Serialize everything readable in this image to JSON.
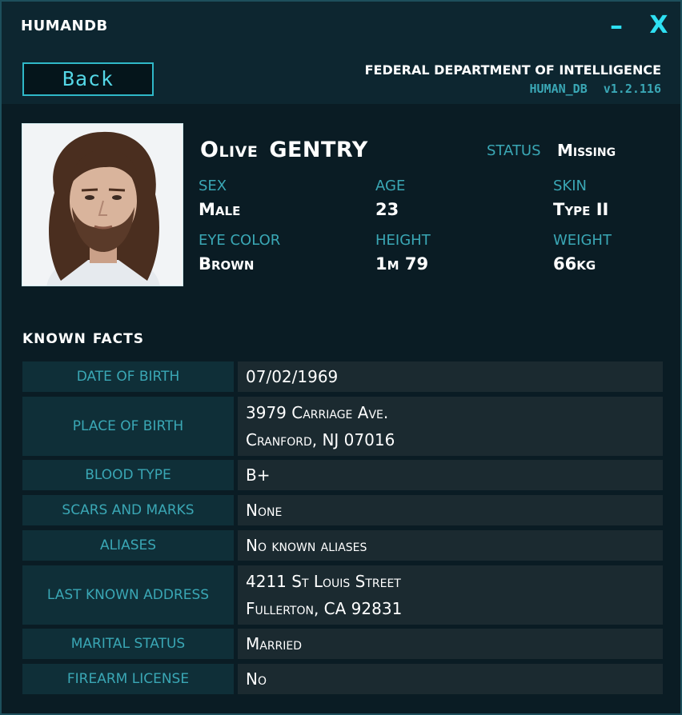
{
  "app": {
    "title": "HUMANDB",
    "minimize_glyph": "–",
    "close_glyph": "X"
  },
  "header": {
    "back_label": "Back",
    "agency": "FEDERAL DEPARTMENT OF INTELLIGENCE",
    "db_name": "HUMAN_DB",
    "version": "v1.2.116"
  },
  "profile": {
    "first_name": "Olive",
    "last_name": "GENTRY",
    "status_label": "STATUS",
    "status_value": "Missing",
    "sex_label": "SEX",
    "sex": "Male",
    "age_label": "AGE",
    "age": "23",
    "skin_label": "SKIN",
    "skin": "Type II",
    "eye_label": "EYE COLOR",
    "eye": "Brown",
    "height_label": "HEIGHT",
    "height": "1m 79",
    "weight_label": "WEIGHT",
    "weight": "66kg"
  },
  "facts": {
    "title_a": "KNOWN",
    "title_b": "FACTS",
    "rows": [
      {
        "label": "DATE OF BIRTH",
        "lines": [
          "07/02/1969"
        ]
      },
      {
        "label": "PLACE OF BIRTH",
        "lines": [
          "3979 Carriage Ave.",
          "Cranford, NJ 07016"
        ]
      },
      {
        "label": "BLOOD TYPE",
        "lines": [
          "B+"
        ]
      },
      {
        "label": "SCARS AND MARKS",
        "lines": [
          "None"
        ]
      },
      {
        "label": "ALIASES",
        "lines": [
          "No known aliases"
        ]
      },
      {
        "label": "LAST KNOWN ADDRESS",
        "lines": [
          "4211 St Louis Street",
          "Fullerton, CA 92831"
        ]
      },
      {
        "label": "MARITAL STATUS",
        "lines": [
          "Married"
        ]
      },
      {
        "label": "FIREARM LICENSE",
        "lines": [
          "No"
        ]
      }
    ]
  },
  "colors": {
    "accent": "#2ee0f2",
    "label": "#3aa7b5",
    "panel": "#0b2029"
  }
}
